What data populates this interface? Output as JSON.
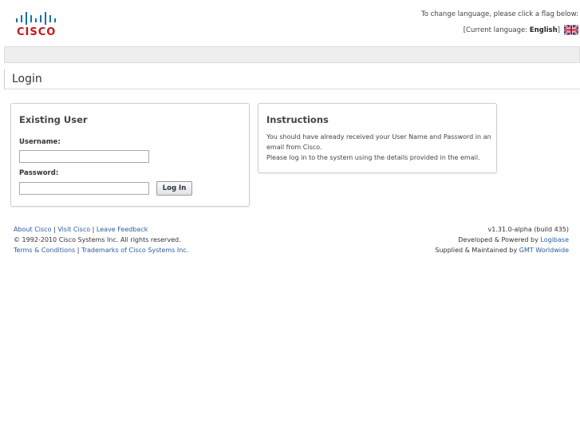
{
  "brand": {
    "logo_text": "CISCO",
    "accent_color": "#c6161c",
    "bars_color": "#1a6fa7"
  },
  "language": {
    "prompt": "To change language, please click a flag below:",
    "current_prefix": "[Current language:",
    "current_value": "English",
    "current_suffix": "]",
    "flag_icon": "uk-flag-icon"
  },
  "page": {
    "title": "Login"
  },
  "login_box": {
    "heading": "Existing User",
    "username_label": "Username:",
    "username_value": "",
    "password_label": "Password:",
    "password_value": "",
    "login_button": "Log In"
  },
  "instructions_box": {
    "heading": "Instructions",
    "line1": "You should have already received your User Name and Password in an email from Cisco.",
    "line2": "Please log in to the system using the details provided in the email."
  },
  "footer": {
    "links_row": [
      "About Cisco",
      "Visit Cisco",
      "Leave Feedback"
    ],
    "separator": "|",
    "copyright": "© 1992-2010 Cisco Systems Inc. All rights reserved.",
    "legal_row": [
      "Terms & Conditions",
      "Trademarks of Cisco Systems Inc."
    ],
    "version": "v1.31.0-alpha (build 435)",
    "developed_prefix": "Developed & Powered by",
    "developed_link": "Logibase",
    "supplied_prefix": "Supplied & Maintained by",
    "supplied_link": "GMT Worldwide"
  }
}
